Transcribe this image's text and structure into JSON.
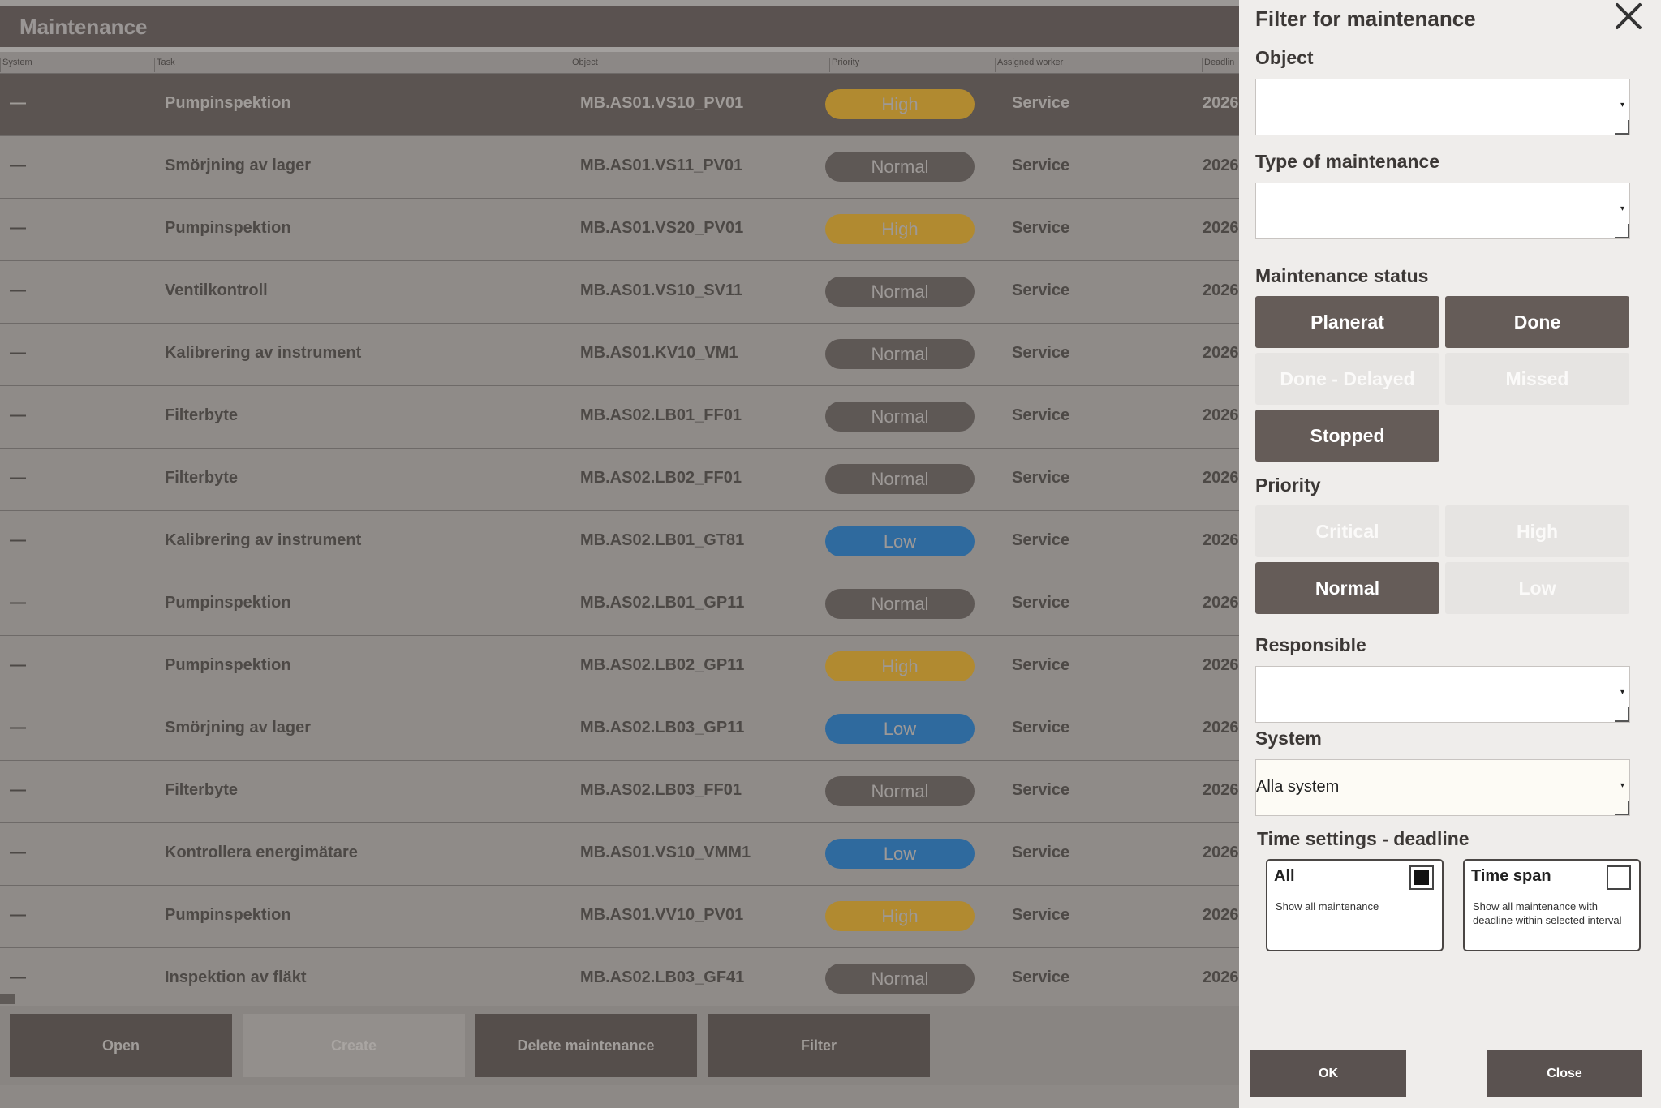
{
  "app": {
    "title": "Maintenance"
  },
  "columns": [
    "System",
    "Task",
    "Object",
    "Priority",
    "Assigned worker",
    "Deadlin"
  ],
  "rows": [
    {
      "system": "—",
      "task": "Pumpinspektion",
      "object": "MB.AS01.VS10_PV01",
      "priority": "High",
      "worker": "Service",
      "deadline": "2026",
      "selected": true
    },
    {
      "system": "—",
      "task": "Smörjning av lager",
      "object": "MB.AS01.VS11_PV01",
      "priority": "Normal",
      "worker": "Service",
      "deadline": "2026"
    },
    {
      "system": "—",
      "task": "Pumpinspektion",
      "object": "MB.AS01.VS20_PV01",
      "priority": "High",
      "worker": "Service",
      "deadline": "2026"
    },
    {
      "system": "—",
      "task": "Ventilkontroll",
      "object": "MB.AS01.VS10_SV11",
      "priority": "Normal",
      "worker": "Service",
      "deadline": "2026"
    },
    {
      "system": "—",
      "task": "Kalibrering av instrument",
      "object": "MB.AS01.KV10_VM1",
      "priority": "Normal",
      "worker": "Service",
      "deadline": "2026"
    },
    {
      "system": "—",
      "task": "Filterbyte",
      "object": "MB.AS02.LB01_FF01",
      "priority": "Normal",
      "worker": "Service",
      "deadline": "2026"
    },
    {
      "system": "—",
      "task": "Filterbyte",
      "object": "MB.AS02.LB02_FF01",
      "priority": "Normal",
      "worker": "Service",
      "deadline": "2026"
    },
    {
      "system": "—",
      "task": "Kalibrering av instrument",
      "object": "MB.AS02.LB01_GT81",
      "priority": "Low",
      "worker": "Service",
      "deadline": "2026"
    },
    {
      "system": "—",
      "task": "Pumpinspektion",
      "object": "MB.AS02.LB01_GP11",
      "priority": "Normal",
      "worker": "Service",
      "deadline": "2026"
    },
    {
      "system": "—",
      "task": "Pumpinspektion",
      "object": "MB.AS02.LB02_GP11",
      "priority": "High",
      "worker": "Service",
      "deadline": "2026"
    },
    {
      "system": "—",
      "task": "Smörjning av lager",
      "object": "MB.AS02.LB03_GP11",
      "priority": "Low",
      "worker": "Service",
      "deadline": "2026"
    },
    {
      "system": "—",
      "task": "Filterbyte",
      "object": "MB.AS02.LB03_FF01",
      "priority": "Normal",
      "worker": "Service",
      "deadline": "2026"
    },
    {
      "system": "—",
      "task": "Kontrollera energimätare",
      "object": "MB.AS01.VS10_VMM1",
      "priority": "Low",
      "worker": "Service",
      "deadline": "2026"
    },
    {
      "system": "—",
      "task": "Pumpinspektion",
      "object": "MB.AS01.VV10_PV01",
      "priority": "High",
      "worker": "Service",
      "deadline": "2026"
    },
    {
      "system": "—",
      "task": "Inspektion av fläkt",
      "object": "MB.AS02.LB03_GF41",
      "priority": "Normal",
      "worker": "Service",
      "deadline": "2026"
    }
  ],
  "actions": {
    "open": "Open",
    "create": "Create",
    "delete": "Delete maintenance",
    "filter": "Filter"
  },
  "filter": {
    "title": "Filter for maintenance",
    "close_icon": "close-icon",
    "object_label": "Object",
    "object_value": "",
    "type_label": "Type of maintenance",
    "type_value": "",
    "status_label": "Maintenance status",
    "status": {
      "planerat": "Planerat",
      "done": "Done",
      "done_delayed": "Done - Delayed",
      "missed": "Missed",
      "stopped": "Stopped"
    },
    "priority_label": "Priority",
    "priority": {
      "critical": "Critical",
      "high": "High",
      "normal": "Normal",
      "low": "Low"
    },
    "responsible_label": "Responsible",
    "responsible_value": "",
    "system_label": "System",
    "system_value": "Alla system",
    "time_label": "Time settings - deadline",
    "time_all_title": "All",
    "time_all_desc": "Show all maintenance",
    "time_span_title": "Time span",
    "time_span_desc": "Show all maintenance with deadline within selected interval",
    "ok": "OK",
    "close": "Close"
  },
  "colors": {
    "high": "#b18a30",
    "normal": "#5e5855",
    "low": "#2f6a9e",
    "active_button": "#655c58"
  }
}
